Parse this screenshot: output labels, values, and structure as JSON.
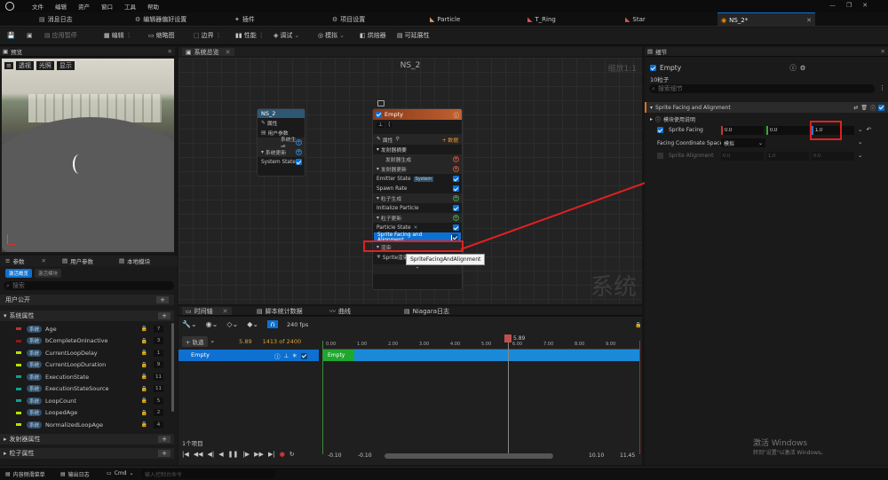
{
  "menu": [
    "文件",
    "编辑",
    "资产",
    "窗口",
    "工具",
    "帮助"
  ],
  "tabs": [
    {
      "label": "消息日志"
    },
    {
      "label": "编辑器偏好设置"
    },
    {
      "label": "插件"
    },
    {
      "label": "项目设置"
    },
    {
      "label": "Particle"
    },
    {
      "label": "T_Ring"
    },
    {
      "label": "Star"
    },
    {
      "label": "NS_2*"
    }
  ],
  "toolbar": {
    "save": "",
    "apply": "应用暂停",
    "compile": "编辑",
    "thumbnail": "缩略图",
    "bounds": "边界",
    "perf": "性能",
    "debug": "调试",
    "simulate": "模拟",
    "baker": "烘焙器",
    "scalability": "可延展性"
  },
  "preview": {
    "title": "预览",
    "view_mode": "透视",
    "lit": "光照",
    "show": "显示"
  },
  "params": {
    "tab_params": "参数",
    "tab_user": "用户参数",
    "tab_local": "本地模块",
    "sub_active": "激活概览",
    "sub_inactive": "激活模块",
    "search_placeholder": "搜索",
    "user_exposed": "用户公开",
    "system_attrs": "系统属性",
    "items": [
      {
        "name": "Age",
        "badge": "系统",
        "count": "7",
        "color": "#c03030"
      },
      {
        "name": "bCompleteOnInactive",
        "badge": "系统",
        "count": "3",
        "color": "#901818"
      },
      {
        "name": "CurrentLoopDelay",
        "badge": "系统",
        "count": "1",
        "color": "#b8e000"
      },
      {
        "name": "CurrentLoopDuration",
        "badge": "系统",
        "count": "9",
        "color": "#b8e000"
      },
      {
        "name": "ExecutionState",
        "badge": "系统",
        "count": "11",
        "color": "#10a090"
      },
      {
        "name": "ExecutionStateSource",
        "badge": "系统",
        "count": "11",
        "color": "#10a090"
      },
      {
        "name": "LoopCount",
        "badge": "系统",
        "count": "5",
        "color": "#10a090"
      },
      {
        "name": "LoopedAge",
        "badge": "系统",
        "count": "2",
        "color": "#b8e000"
      },
      {
        "name": "NormalizedLoopAge",
        "badge": "系统",
        "count": "4",
        "color": "#b8e000"
      }
    ],
    "emitter_attrs": "发射器属性",
    "particle_attrs": "粒子属性"
  },
  "graph": {
    "title": "系统总览",
    "name": "NS_2",
    "zoom": "缩放1:1",
    "watermark": "系统",
    "system_node": {
      "title": "NS_2",
      "rows": [
        "属性",
        "用户参数",
        "系统生成",
        "系统更新",
        "System State"
      ]
    },
    "emitter_node": {
      "title": "Empty",
      "props": "属性",
      "add": "+ 数据",
      "rows": [
        "发射器摘要",
        "发射器生成",
        "发射器更新",
        "Emitter State",
        "System",
        "Spawn Rate",
        "粒子生成",
        "Initialize Particle",
        "粒子更新",
        "Particle State",
        "Sprite Facing and Alignment",
        "渲染",
        "Sprite渲染器"
      ]
    },
    "tooltip": "SpriteFacingAndAlignment"
  },
  "timeline": {
    "tabs": [
      "时间轴",
      "脚本统计数据",
      "曲线",
      "Niagara日志"
    ],
    "add_track": "+ 轨道",
    "time": "5.89",
    "frame": "1413 of 2400",
    "fps": "240 fps",
    "track": "Empty",
    "bar": "Empty",
    "items": "1个项目",
    "ruler": [
      "0.00",
      "1.00",
      "2.00",
      "3.00",
      "4.00",
      "5.00",
      "6.00",
      "7.00",
      "8.00",
      "9.00"
    ],
    "playhead": "5.89",
    "range": [
      "-0.10",
      "-0.10",
      "10.10",
      "11.45"
    ]
  },
  "details": {
    "title": "细节",
    "emitter": "Empty",
    "sub": "10粒子",
    "search_placeholder": "搜索细节",
    "module": "Sprite Facing and Alignment",
    "usage": "模块使用说明",
    "facing_label": "Sprite Facing",
    "facing": [
      "0.0",
      "0.0",
      "1.0"
    ],
    "coord_label": "Facing Coordinate Space",
    "coord_value": "模拟",
    "align_label": "Sprite Alignment",
    "align": [
      "0.0",
      "1.0",
      "0.0"
    ]
  },
  "status": {
    "content_drawer": "内容侧滑菜单",
    "output": "输出日志",
    "cmd": "Cmd",
    "cmd_placeholder": "输入控制台命令",
    "activate1": "激活 Windows",
    "activate2": "转到\"设置\"以激活 Windows。"
  },
  "colors": {
    "accent": "#0e70d0",
    "emitter_header": "#c06030",
    "annotation": "#e02020"
  }
}
